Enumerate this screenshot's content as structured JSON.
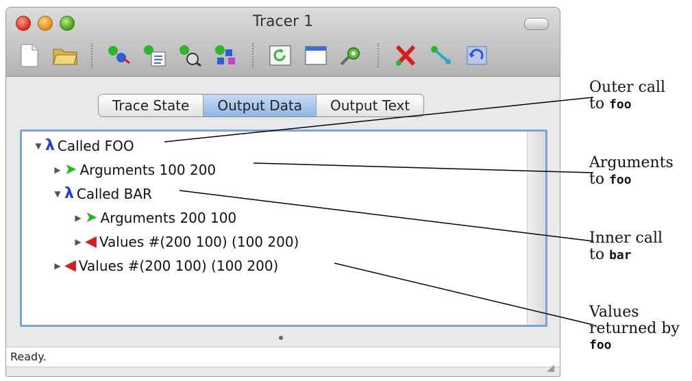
{
  "window": {
    "title": "Tracer 1",
    "tabs": [
      {
        "label": "Trace State",
        "active": false
      },
      {
        "label": "Output Data",
        "active": true
      },
      {
        "label": "Output Text",
        "active": false
      }
    ],
    "status": "Ready."
  },
  "toolbar": {
    "icons": [
      "new-document-icon",
      "open-folder-icon",
      "trace-start-icon",
      "trace-list-icon",
      "trace-inspect-icon",
      "trace-tree-icon",
      "refresh-icon",
      "window-icon",
      "settings-icon",
      "delete-icon",
      "step-icon",
      "undo-icon"
    ]
  },
  "tree": {
    "rows": [
      {
        "triangle": "▼",
        "glyph": "λ",
        "text": "Called FOO"
      },
      {
        "triangle": "▶",
        "glyph": "➤",
        "text": "Arguments 100 200"
      },
      {
        "triangle": "▼",
        "glyph": "λ",
        "text": "Called BAR"
      },
      {
        "triangle": "▶",
        "glyph": "➤",
        "text": "Arguments 200 100"
      },
      {
        "triangle": "▶",
        "glyph": "◀",
        "text": "Values #(200 100) (100 200)"
      },
      {
        "triangle": "▶",
        "glyph": "◀",
        "text": "Values #(200 100) (100 200)"
      }
    ]
  },
  "annotations": [
    {
      "line1": "Outer call",
      "prefix": "to",
      "code": "foo"
    },
    {
      "line1": "Arguments",
      "prefix": "to",
      "code": "foo"
    },
    {
      "line1": "Inner call",
      "prefix": "to",
      "code": "bar"
    },
    {
      "line1": "Values",
      "line2": "returned by",
      "code": "foo"
    }
  ],
  "colors": {
    "lambda": "#1f3fd6",
    "arguments_arrow": "#27b520",
    "values_arrow": "#d81c1c",
    "content_border": "#7aa4d8"
  }
}
